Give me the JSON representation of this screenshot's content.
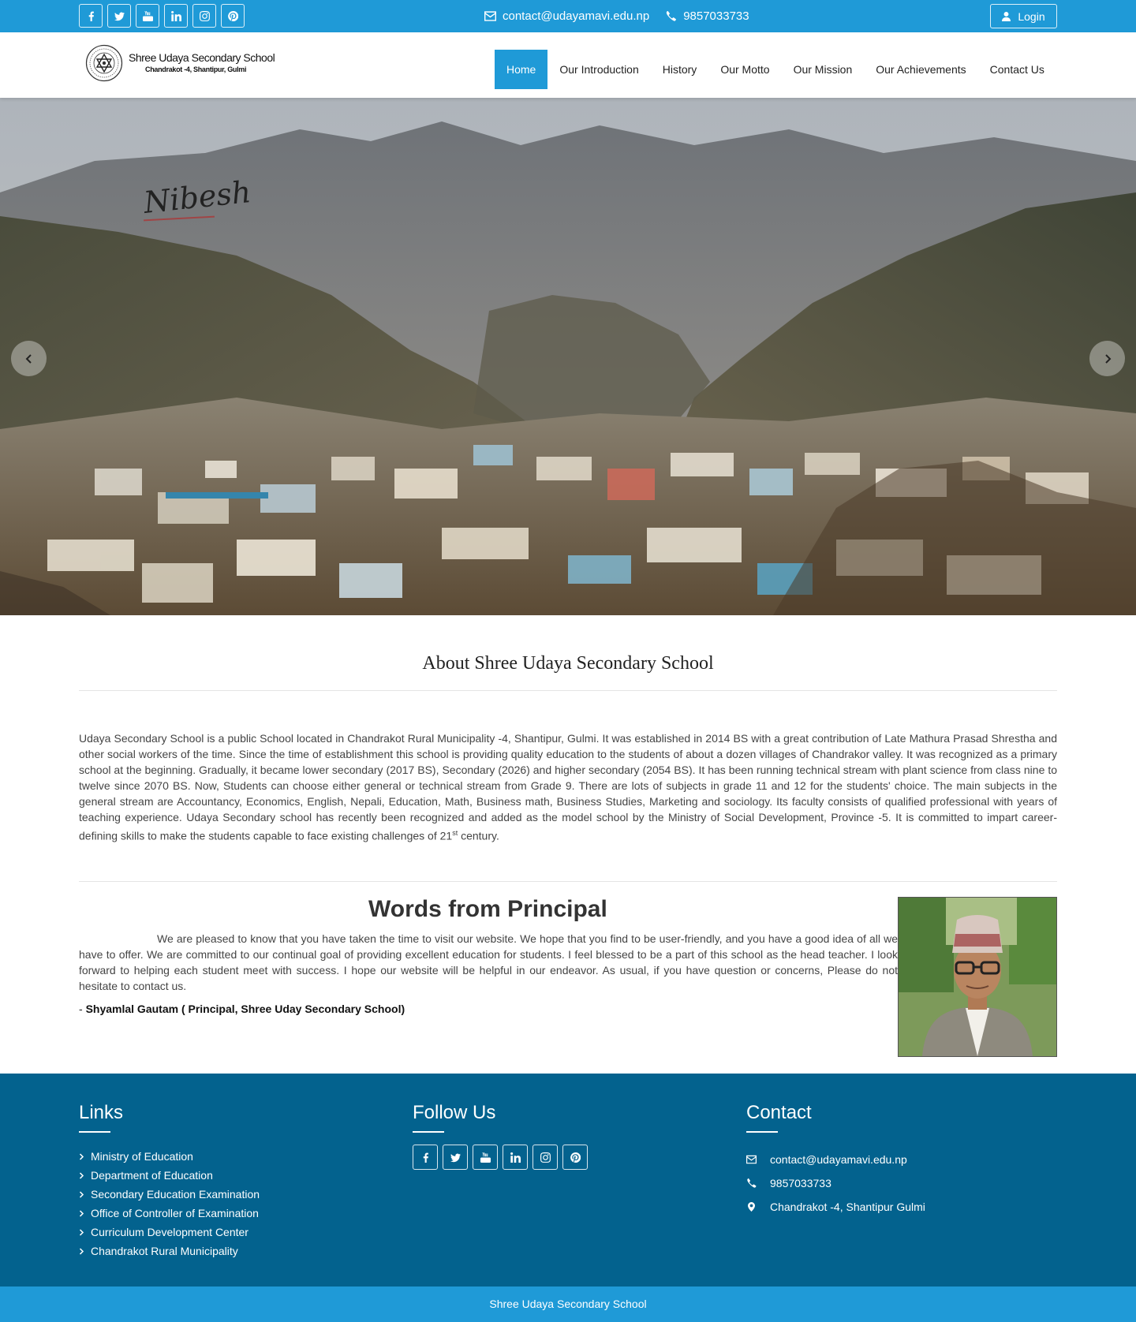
{
  "topbar": {
    "social_icons": [
      "facebook-icon",
      "twitter-icon",
      "youtube-icon",
      "linkedin-icon",
      "instagram-icon",
      "pinterest-icon"
    ],
    "email": "contact@udayamavi.edu.np",
    "phone": "9857033733",
    "login_label": "Login"
  },
  "header": {
    "school_name": "Shree Udaya Secondary School",
    "school_address": "Chandrakot -4, Shantipur, Gulmi",
    "nav": [
      "Home",
      "Our Introduction",
      "History",
      "Our Motto",
      "Our Mission",
      "Our Achievements",
      "Contact Us"
    ],
    "active_nav": "Home"
  },
  "hero": {
    "watermark": "Nibesh"
  },
  "about": {
    "title": "About Shree Udaya Secondary School",
    "text": "Udaya Secondary School is a public School located in Chandrakot Rural Municipality -4, Shantipur, Gulmi. It was established in 2014 BS with a great contribution of Late Mathura Prasad Shrestha and other social workers of the time. Since the time of establishment this school is providing quality education to the students of about a dozen villages of Chandrakor valley. It was recognized as a primary school at the beginning. Gradually, it became lower secondary (2017 BS), Secondary (2026) and higher secondary (2054 BS). It has been running technical stream with plant science from class nine to twelve since 2070 BS. Now, Students can choose either general or technical stream from Grade 9. There are lots of subjects in grade 11 and 12 for the students' choice. The main subjects in the general stream are Accountancy, Economics, English, Nepali, Education, Math, Business math, Business Studies, Marketing and sociology. Its faculty consists of qualified professional with years of teaching experience. Udaya Secondary school has recently been recognized and added as the model school by the Ministry of Social Development, Province -5. It is committed to impart career-defining skills to make the students capable to face existing challenges of 21",
    "sup": "st",
    "text_end": " century."
  },
  "principal": {
    "title": "Words from Principal",
    "message": "We are pleased to know that you have taken the time to visit our website. We hope that you find to be user-friendly, and you have a good idea of all we have to offer. We are committed to our continual goal of providing excellent education for students. I feel blessed to be a part of this school as the head teacher. I look forward to helping each student meet with success. I hope our website will be helpful in our endeavor. As usual, if you have question or concerns, Please do not hesitate to contact us.",
    "sign_prefix": "- ",
    "signature": "Shyamlal Gautam ( Principal, Shree Uday Secondary School)"
  },
  "footer": {
    "links_title": "Links",
    "links": [
      "Ministry of Education",
      "Department of Education",
      "Secondary Education Examination",
      "Office of Controller of Examination",
      "Curriculum Development Center",
      "Chandrakot Rural Municipality"
    ],
    "follow_title": "Follow Us",
    "contact_title": "Contact",
    "contact_email": "contact@udayamavi.edu.np",
    "contact_phone": "9857033733",
    "contact_address": "Chandrakot -4, Shantipur Gulmi",
    "bottom_text": "Shree Udaya Secondary School"
  },
  "colors": {
    "topbar": "#1f9ad7",
    "footer": "#03628e",
    "accent": "#1f9ad7"
  }
}
